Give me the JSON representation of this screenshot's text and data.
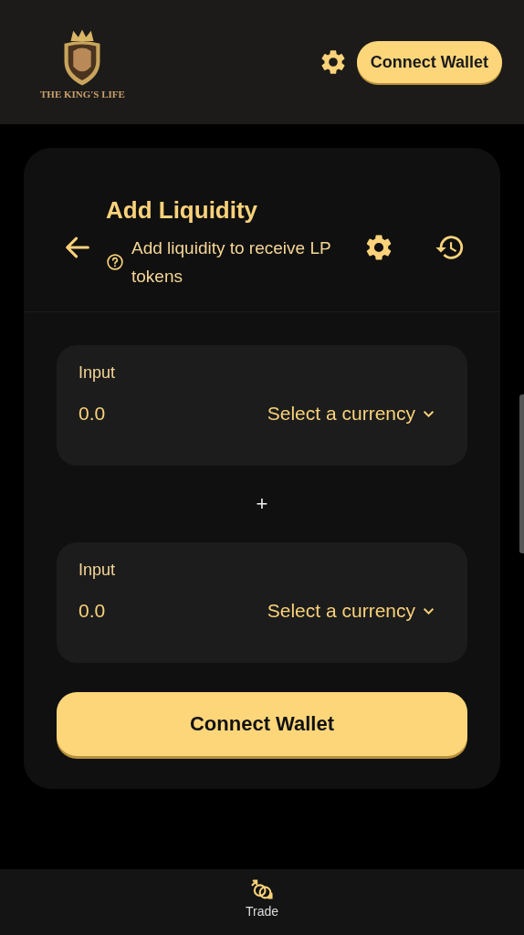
{
  "header": {
    "brand": "THE KING'S LIFE",
    "connect_button": "Connect Wallet"
  },
  "card": {
    "title": "Add Liquidity",
    "subtitle": "Add liquidity to receive LP tokens",
    "inputs": [
      {
        "label": "Input",
        "value": "0.0",
        "currency_button": "Select a currency"
      },
      {
        "label": "Input",
        "value": "0.0",
        "currency_button": "Select a currency"
      }
    ],
    "separator": "+",
    "connect_button": "Connect Wallet"
  },
  "bottom_nav": [
    {
      "label": "Trade",
      "selected": true
    }
  ]
}
